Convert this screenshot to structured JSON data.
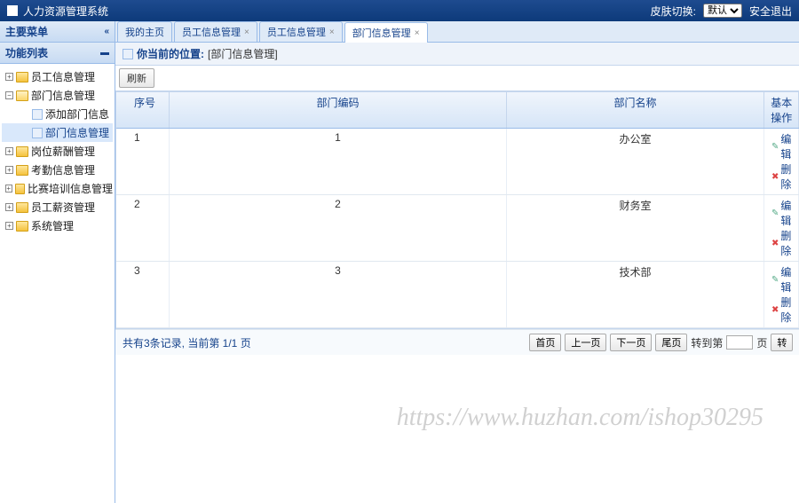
{
  "header": {
    "title": "人力资源管理系统",
    "skin_label": "皮肤切换:",
    "skin_options": [
      "默认"
    ],
    "skin_selected": "默认",
    "logout": "安全退出"
  },
  "sidebar": {
    "main_menu_title": "主要菜单",
    "panel_title": "功能列表",
    "nodes": [
      {
        "label": "员工信息管理",
        "expanded": false,
        "children": []
      },
      {
        "label": "部门信息管理",
        "expanded": true,
        "children": [
          {
            "label": "添加部门信息",
            "selected": false
          },
          {
            "label": "部门信息管理",
            "selected": true
          }
        ]
      },
      {
        "label": "岗位薪酬管理",
        "expanded": false,
        "children": []
      },
      {
        "label": "考勤信息管理",
        "expanded": false,
        "children": []
      },
      {
        "label": "比赛培训信息管理",
        "expanded": false,
        "children": []
      },
      {
        "label": "员工薪资管理",
        "expanded": false,
        "children": []
      },
      {
        "label": "系统管理",
        "expanded": false,
        "children": []
      }
    ]
  },
  "tabs": [
    {
      "label": "我的主页",
      "closable": false,
      "active": false
    },
    {
      "label": "员工信息管理",
      "closable": true,
      "active": false
    },
    {
      "label": "员工信息管理",
      "closable": true,
      "active": false
    },
    {
      "label": "部门信息管理",
      "closable": true,
      "active": true
    }
  ],
  "breadcrumb": {
    "label": "你当前的位置:",
    "path": "[部门信息管理]"
  },
  "toolbar": {
    "refresh": "刷新"
  },
  "grid": {
    "columns": {
      "seq": "序号",
      "code": "部门编码",
      "name": "部门名称",
      "ops": "基本操作"
    },
    "ops_labels": {
      "edit": "编辑",
      "delete": "删除"
    },
    "rows": [
      {
        "seq": "1",
        "code": "1",
        "name": "办公室"
      },
      {
        "seq": "2",
        "code": "2",
        "name": "财务室"
      },
      {
        "seq": "3",
        "code": "3",
        "name": "技术部"
      }
    ]
  },
  "pager": {
    "info": "共有3条记录, 当前第 1/1 页",
    "first": "首页",
    "prev": "上一页",
    "next": "下一页",
    "last": "尾页",
    "goto_label": "转到第",
    "page_unit": "页",
    "go": "转",
    "goto_value": ""
  },
  "watermark": "https://www.huzhan.com/ishop30295"
}
